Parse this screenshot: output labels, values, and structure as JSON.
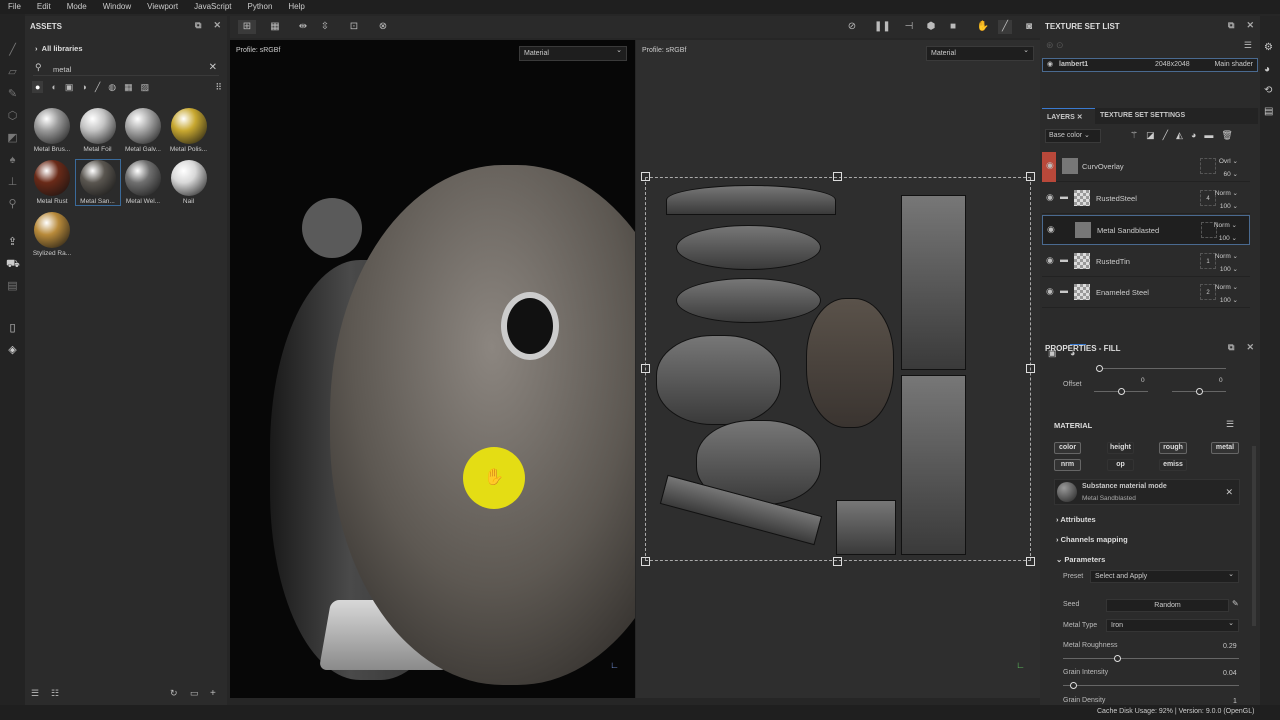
{
  "menu": [
    "File",
    "Edit",
    "Mode",
    "Window",
    "Viewport",
    "JavaScript",
    "Python",
    "Help"
  ],
  "assets": {
    "title": "ASSETS",
    "library": "All libraries",
    "search": "metal",
    "items": [
      {
        "label": "Metal Brus...",
        "color": "#9a9a9a"
      },
      {
        "label": "Metal Foil",
        "color": "#c4c4c4"
      },
      {
        "label": "Metal Galv...",
        "color": "#aaaaaa"
      },
      {
        "label": "Metal Polis...",
        "color": "#c8a830"
      },
      {
        "label": "Metal Rust",
        "color": "#6a2a18"
      },
      {
        "label": "Metal San...",
        "color": "#5a5650",
        "selected": true
      },
      {
        "label": "Metal Wel...",
        "color": "#707070"
      },
      {
        "label": "Nail",
        "color": "#d8d8d8"
      },
      {
        "label": "Stylized Ra...",
        "color": "#b88a3a"
      }
    ]
  },
  "viewport": {
    "left": {
      "profile": "Profile: sRGBf",
      "mode": "Material"
    },
    "right": {
      "profile": "Profile: sRGBf",
      "mode": "Material"
    }
  },
  "texture_set_list": {
    "title": "TEXTURE SET LIST",
    "row": {
      "name": "lambert1",
      "resolution": "2048x2048",
      "shader": "Main shader"
    }
  },
  "layers": {
    "tab_layers": "LAYERS",
    "tab_settings": "TEXTURE SET SETTINGS",
    "channel": "Base color",
    "items": [
      {
        "name": "CurvOverlay",
        "blend": "Ovrl",
        "opacity": "60",
        "mask": "",
        "highlight": "#b8483a"
      },
      {
        "name": "RustedSteel",
        "blend": "Norm",
        "opacity": "100",
        "mask": "4",
        "folder": true
      },
      {
        "name": "Metal Sandblasted",
        "blend": "Norm",
        "opacity": "100",
        "mask": "",
        "selected": true
      },
      {
        "name": "RustedTin",
        "blend": "Norm",
        "opacity": "100",
        "mask": "1",
        "folder": true
      },
      {
        "name": "Enameled Steel",
        "blend": "Norm",
        "opacity": "100",
        "mask": "2",
        "folder": true
      }
    ]
  },
  "properties": {
    "title": "PROPERTIES - FILL",
    "offset_label": "Offset",
    "offset_x": "0",
    "offset_y": "0",
    "material_title": "MATERIAL",
    "channels": [
      "color",
      "height",
      "rough",
      "metal",
      "nrm",
      "op",
      "emiss"
    ],
    "mode_title": "Substance material mode",
    "mode_material": "Metal Sandblasted",
    "attributes": "Attributes",
    "channels_mapping": "Channels mapping",
    "parameters": "Parameters",
    "preset_label": "Preset",
    "preset_value": "Select and Apply",
    "seed_label": "Seed",
    "seed_value": "Random",
    "metal_type_label": "Metal Type",
    "metal_type_value": "Iron",
    "roughness_label": "Metal Roughness",
    "roughness_value": "0.29",
    "roughness_frac": 0.29,
    "grain_label": "Grain Intensity",
    "grain_value": "0.04",
    "grain_frac": 0.04,
    "density_label": "Grain Density",
    "density_value": "1"
  },
  "status": "Cache Disk Usage:   92% | Version: 9.0.0 (OpenGL)"
}
